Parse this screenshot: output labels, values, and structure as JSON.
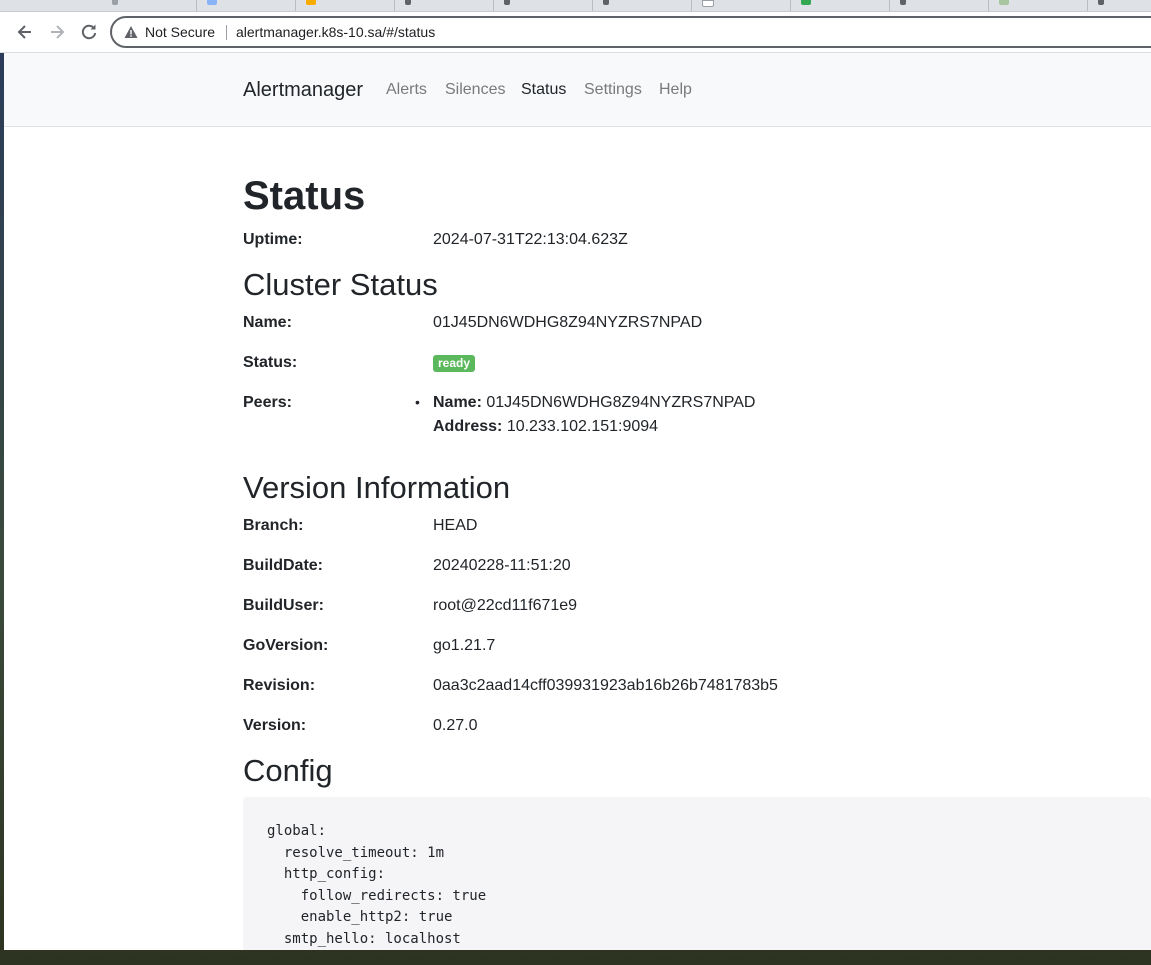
{
  "browser": {
    "security_label": "Not Secure",
    "url": "alertmanager.k8s-10.sa/#/status",
    "back_icon": "back-arrow-icon",
    "forward_icon": "forward-arrow-icon",
    "reload_icon": "reload-icon",
    "warning_icon": "warning-triangle-icon"
  },
  "nav": {
    "brand": "Alertmanager",
    "links": [
      "Alerts",
      "Silences",
      "Status",
      "Settings",
      "Help"
    ],
    "active": "Status"
  },
  "status": {
    "title": "Status",
    "uptime_label": "Uptime:",
    "uptime_value": "2024-07-31T22:13:04.623Z"
  },
  "cluster": {
    "title": "Cluster Status",
    "name_label": "Name:",
    "name_value": "01J45DN6WDHG8Z94NYZRS7NPAD",
    "status_label": "Status:",
    "status_value": "ready",
    "status_color": "#5cb85c",
    "peers_label": "Peers:",
    "peer_name_label": "Name:",
    "peer_name_value": "01J45DN6WDHG8Z94NYZRS7NPAD",
    "peer_address_label": "Address:",
    "peer_address_value": "10.233.102.151:9094"
  },
  "version": {
    "title": "Version Information",
    "rows": [
      {
        "label": "Branch:",
        "value": "HEAD"
      },
      {
        "label": "BuildDate:",
        "value": "20240228-11:51:20"
      },
      {
        "label": "BuildUser:",
        "value": "root@22cd11f671e9"
      },
      {
        "label": "GoVersion:",
        "value": "go1.21.7"
      },
      {
        "label": "Revision:",
        "value": "0aa3c2aad14cff039931923ab16b26b7481783b5"
      },
      {
        "label": "Version:",
        "value": "0.27.0"
      }
    ]
  },
  "config": {
    "title": "Config",
    "text": "global:\n  resolve_timeout: 1m\n  http_config:\n    follow_redirects: true\n    enable_http2: true\n  smtp_hello: localhost"
  }
}
